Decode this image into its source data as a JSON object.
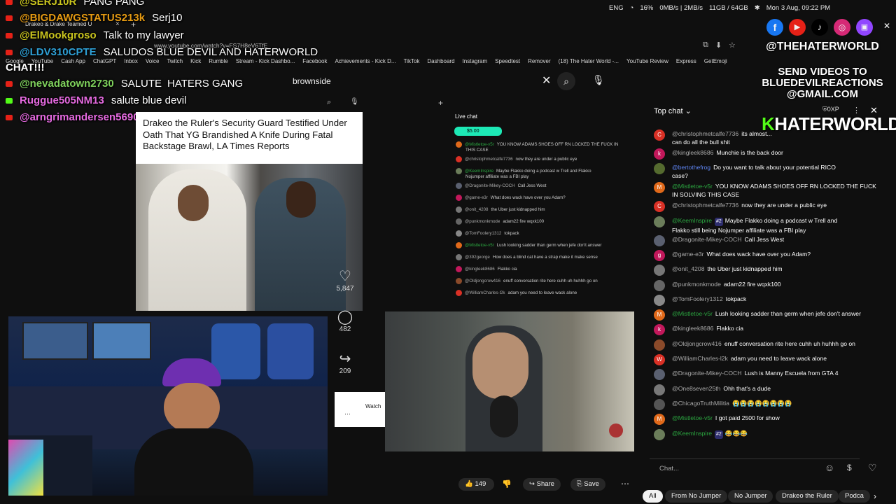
{
  "overlay_chat": [
    {
      "user": "@SERJ10R",
      "msg": "PANG PANG",
      "color": "#c9c41e",
      "platform": "yt"
    },
    {
      "user": "@BIGDAWGSTATUS213k",
      "msg": "Serj10",
      "color": "#e59a12",
      "platform": "yt"
    },
    {
      "user": "@ElMookgroso",
      "msg": "Talk to my lawyer",
      "color": "#c9c41e",
      "platform": "yt"
    },
    {
      "user": "@LDV310CPTE",
      "msg": "SALUDOS BLUE DEVIL AND HATERWORLD",
      "color": "#2ea0d6",
      "platform": "yt"
    },
    {
      "user": "CHAT!!!",
      "msg": "",
      "color": "#ffffff",
      "platform": "none"
    },
    {
      "user": "@nevadatown2730",
      "msg": "SALUTE",
      "msg2": "HATERS GANG",
      "color": "#7fd15c",
      "platform": "yt"
    },
    {
      "user": "Ruggue505NM13",
      "msg": "salute blue devil",
      "color": "#e56ae0",
      "platform": "kick"
    },
    {
      "user": "@arngrimandersen5690",
      "msg": "",
      "color": "#e56ae0",
      "platform": "yt"
    }
  ],
  "browser": {
    "tab_title": "Drakeo & Drake Teamed U",
    "url": "www.youtube.com/watch?v=FS7H8eV6TfE",
    "bookmarks": [
      "Google",
      "YouTube",
      "Cash App",
      "ChatGPT",
      "Inbox",
      "Voice",
      "Twitch",
      "Kick",
      "Rumble",
      "Stream - Kick Dashbo...",
      "Facebook",
      "Achievements - Kick D...",
      "TikTok",
      "Dashboard",
      "Instagram",
      "Speedtest",
      "Remover",
      "(18) The Hater World -...",
      "YouTube Review",
      "Express",
      "GetEmoji"
    ]
  },
  "tray": {
    "lang": "ENG",
    "battery": "16%",
    "net": "0MB/s | 2MB/s",
    "mem": "11GB / 64GB",
    "datetime": "Mon 3 Aug, 09:22 PM"
  },
  "search": {
    "query": "brownside"
  },
  "article": {
    "title": "Drakeo the Ruler's Security Guard Testified Under Oath That YG Brandished A Knife During Fatal Backstage Brawl, LA Times Reports"
  },
  "actions": {
    "likes": "5,847",
    "comments": "482",
    "shares": "209"
  },
  "mid_chat": {
    "header": "Live chat",
    "superchat": "$5.00",
    "rows": [
      {
        "user": "@Mistletoe-v5r",
        "msg": "YOU KNOW ADAMS SHOES OFF RN LOCKED THE FUCK IN",
        "msg2": "THIS CASE",
        "color": "#e0691a"
      },
      {
        "user": "@christophmetcalfe7736",
        "msg": "now they are under a public eye",
        "color": "#d93025"
      },
      {
        "user": "@KeemInspire",
        "msg": "Maybe Flakko doing a podcast w Trell and Flakko",
        "msg2": "Nojumper affiliate was a FBI play",
        "color": "#6b7d5a"
      },
      {
        "user": "@Dragonite-Mikey-COCH",
        "msg": "Call Jess West",
        "color": "#5a6070"
      },
      {
        "user": "@game-e3r",
        "msg": "What does wack have over you Adam?",
        "color": "#c2185b"
      },
      {
        "user": "@onit_4208",
        "msg": "the Uber just kidnapped him",
        "color": "#777"
      },
      {
        "user": "@punkmonkmode",
        "msg": "adam22 fire wqxk100",
        "color": "#666"
      },
      {
        "user": "@TomFoolery1312",
        "msg": "tokpack",
        "color": "#888"
      },
      {
        "user": "@Mistletoe-v5r",
        "msg": "Lush looking sadder than germ when jefe don't answer",
        "color": "#e0691a"
      },
      {
        "user": "@392george",
        "msg": "How does a blind cat have a strap make it make sense",
        "color": "#777"
      },
      {
        "user": "@kingleek8686",
        "msg": "Flakko cia",
        "color": "#c2185b"
      },
      {
        "user": "@Oldjongcrow416",
        "msg": "enuff conversation rite here cuhh uh huhhh go on",
        "color": "#8a4a2a"
      },
      {
        "user": "@WilliamCharles-l2k",
        "msg": "adam you need to leave wack alone",
        "color": "#d93025"
      }
    ]
  },
  "right_chat": {
    "header": "Top chat",
    "rows": [
      {
        "user": "@christophmetcalfe7736",
        "msg": "its almost...",
        "msg2": "can do all the bull shit",
        "avatar": "C",
        "color": "#d93025",
        "name_class": ""
      },
      {
        "user": "@kingleek8686",
        "msg": "Munchie is the back door",
        "avatar": "k",
        "color": "#c2185b",
        "name_class": ""
      },
      {
        "user": "@bertothefrog",
        "msg": "Do you want to talk about your potential RICO",
        "msg2": "case?",
        "avatar": "",
        "color": "#556b2f",
        "name_class": "b"
      },
      {
        "user": "@Mistletoe-v5r",
        "msg": "YOU KNOW ADAMS SHOES OFF RN LOCKED THE FUCK",
        "msg2": "IN SOLVING THIS CASE",
        "avatar": "M",
        "color": "#e0691a",
        "name_class": "g"
      },
      {
        "user": "@christophmetcalfe7736",
        "msg": "now they are under a public eye",
        "avatar": "C",
        "color": "#d93025",
        "name_class": ""
      },
      {
        "user": "@KeemInspire",
        "badge": "#2",
        "msg": "Maybe Flakko doing a podcast w Trell and",
        "msg2": "Flakko still being Nojumper affiliate was a FBI play",
        "avatar": "",
        "color": "#6b7d5a",
        "name_class": "g"
      },
      {
        "user": "@Dragonite-Mikey-COCH",
        "msg": "Call Jess West",
        "avatar": "",
        "color": "#5a6070",
        "name_class": ""
      },
      {
        "user": "@game-e3r",
        "msg": "What does wack have over you Adam?",
        "avatar": "g",
        "color": "#c2185b",
        "name_class": ""
      },
      {
        "user": "@onit_4208",
        "msg": "the Uber just kidnapped him",
        "avatar": "",
        "color": "#777",
        "name_class": ""
      },
      {
        "user": "@punkmonkmode",
        "msg": "adam22 fire wqxk100",
        "avatar": "",
        "color": "#666",
        "name_class": ""
      },
      {
        "user": "@TomFoolery1312",
        "msg": "tokpack",
        "avatar": "",
        "color": "#888",
        "name_class": ""
      },
      {
        "user": "@Mistletoe-v5r",
        "msg": "Lush looking sadder than germ when jefe don't answer",
        "avatar": "M",
        "color": "#e0691a",
        "name_class": "g"
      },
      {
        "user": "@kingleek8686",
        "msg": "Flakko cia",
        "avatar": "k",
        "color": "#c2185b",
        "name_class": ""
      },
      {
        "user": "@Oldjongcrow416",
        "msg": "enuff conversation rite here cuhh uh huhhh go on",
        "avatar": "",
        "color": "#8a4a2a",
        "name_class": ""
      },
      {
        "user": "@WilliamCharles-l2k",
        "msg": "adam you need to leave wack alone",
        "avatar": "W",
        "color": "#d93025",
        "name_class": ""
      },
      {
        "user": "@Dragonite-Mikey-COCH",
        "msg": "Lush is Manny Escuela from GTA 4",
        "avatar": "",
        "color": "#5a6070",
        "name_class": ""
      },
      {
        "user": "@One8seven25th",
        "msg": "Ohh that's a dude",
        "avatar": "",
        "color": "#777",
        "name_class": ""
      },
      {
        "user": "@ChicagoTruthMilitia",
        "msg": "😭😭😭😭😭😭😭😭",
        "avatar": "",
        "color": "#555",
        "name_class": ""
      },
      {
        "user": "@Mistletoe-v5r",
        "msg": "I got paid 2500 for show",
        "avatar": "M",
        "color": "#e0691a",
        "name_class": "g"
      },
      {
        "user": "@KeemInspire",
        "badge": "#2",
        "msg": "😂😂😂",
        "avatar": "",
        "color": "#6b7d5a",
        "name_class": "g"
      }
    ],
    "input_placeholder": "Chat..."
  },
  "video_actions": {
    "likes": "149",
    "share": "Share",
    "save": "Save"
  },
  "filter_chips": [
    "All",
    "From No Jumper",
    "No Jumper",
    "Drakeo the Ruler",
    "Podca"
  ],
  "watch_label": "Watch",
  "branding": {
    "social": "@THEHATERWORLD",
    "send": "SEND VIDEOS TO",
    "name": "BLUEDEVILREACTIONS",
    "email": "@GMAIL.COM",
    "logo": "HATERWORLD",
    "xp": "0XP"
  }
}
